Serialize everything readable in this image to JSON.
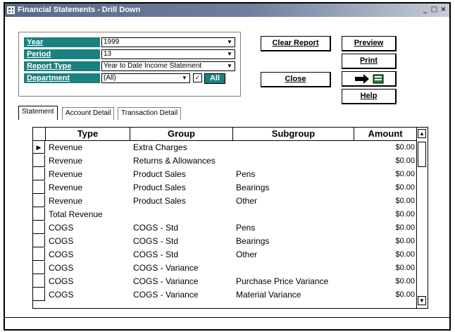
{
  "window": {
    "title": "Financial Statements - Drill Down"
  },
  "filters": [
    {
      "label": "Year",
      "value": "1999"
    },
    {
      "label": "Period",
      "value": "13"
    },
    {
      "label": "Report Type",
      "value": "Year to Date Income Statement"
    },
    {
      "label": "Department",
      "value": "(All)",
      "check": "✓",
      "all_label": "All"
    }
  ],
  "buttons": {
    "clear_report": "Clear Report",
    "close": "Close",
    "preview": "Preview",
    "print": "Print",
    "help": "Help"
  },
  "tabs": [
    "Statement",
    "Account Detail",
    "Transaction Detail"
  ],
  "grid": {
    "headers": [
      "Type",
      "Group",
      "Subgroup",
      "Amount"
    ],
    "rows": [
      {
        "type": "Revenue",
        "group": "Extra Charges",
        "subgroup": "",
        "amount": "$0.00"
      },
      {
        "type": "Revenue",
        "group": "Returns & Allowances",
        "subgroup": "",
        "amount": "$0.00"
      },
      {
        "type": "Revenue",
        "group": "Product Sales",
        "subgroup": "Pens",
        "amount": "$0.00"
      },
      {
        "type": "Revenue",
        "group": "Product Sales",
        "subgroup": "Bearings",
        "amount": "$0.00"
      },
      {
        "type": "Revenue",
        "group": "Product Sales",
        "subgroup": "Other",
        "amount": "$0.00"
      },
      {
        "type": "Total Revenue",
        "group": "",
        "subgroup": "",
        "amount": "$0.00"
      },
      {
        "type": "COGS",
        "group": "COGS - Std",
        "subgroup": "Pens",
        "amount": "$0.00"
      },
      {
        "type": "COGS",
        "group": "COGS - Std",
        "subgroup": "Bearings",
        "amount": "$0.00"
      },
      {
        "type": "COGS",
        "group": "COGS - Std",
        "subgroup": "Other",
        "amount": "$0.00"
      },
      {
        "type": "COGS",
        "group": "COGS - Variance",
        "subgroup": "",
        "amount": "$0.00"
      },
      {
        "type": "COGS",
        "group": "COGS - Variance",
        "subgroup": "Purchase Price Variance",
        "amount": "$0.00"
      },
      {
        "type": "COGS",
        "group": "COGS - Variance",
        "subgroup": "Material Variance",
        "amount": "$0.00"
      }
    ]
  }
}
